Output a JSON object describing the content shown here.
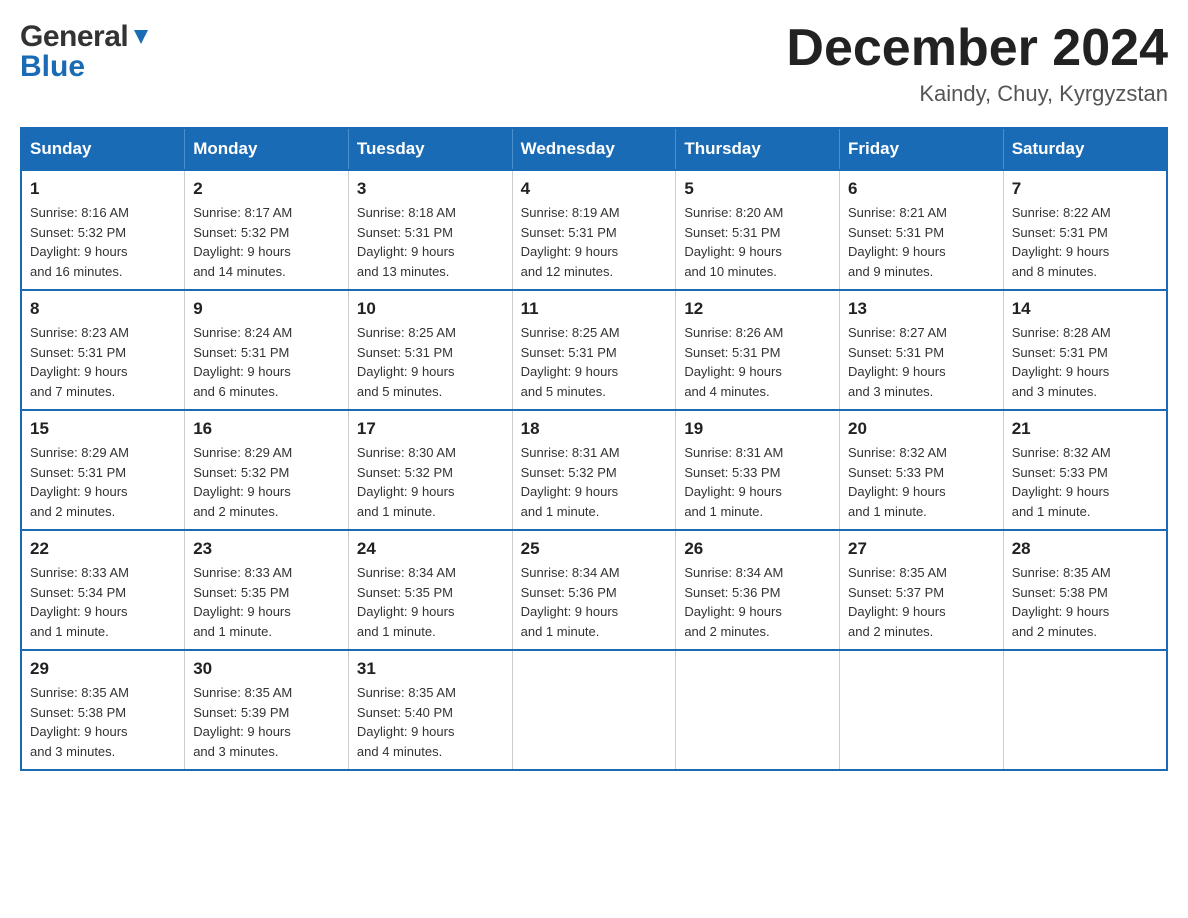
{
  "header": {
    "logo_general": "General",
    "logo_blue": "Blue",
    "title": "December 2024",
    "subtitle": "Kaindy, Chuy, Kyrgyzstan"
  },
  "calendar": {
    "days_of_week": [
      "Sunday",
      "Monday",
      "Tuesday",
      "Wednesday",
      "Thursday",
      "Friday",
      "Saturday"
    ],
    "weeks": [
      [
        {
          "day": "1",
          "sunrise": "8:16 AM",
          "sunset": "5:32 PM",
          "daylight": "9 hours and 16 minutes."
        },
        {
          "day": "2",
          "sunrise": "8:17 AM",
          "sunset": "5:32 PM",
          "daylight": "9 hours and 14 minutes."
        },
        {
          "day": "3",
          "sunrise": "8:18 AM",
          "sunset": "5:31 PM",
          "daylight": "9 hours and 13 minutes."
        },
        {
          "day": "4",
          "sunrise": "8:19 AM",
          "sunset": "5:31 PM",
          "daylight": "9 hours and 12 minutes."
        },
        {
          "day": "5",
          "sunrise": "8:20 AM",
          "sunset": "5:31 PM",
          "daylight": "9 hours and 10 minutes."
        },
        {
          "day": "6",
          "sunrise": "8:21 AM",
          "sunset": "5:31 PM",
          "daylight": "9 hours and 9 minutes."
        },
        {
          "day": "7",
          "sunrise": "8:22 AM",
          "sunset": "5:31 PM",
          "daylight": "9 hours and 8 minutes."
        }
      ],
      [
        {
          "day": "8",
          "sunrise": "8:23 AM",
          "sunset": "5:31 PM",
          "daylight": "9 hours and 7 minutes."
        },
        {
          "day": "9",
          "sunrise": "8:24 AM",
          "sunset": "5:31 PM",
          "daylight": "9 hours and 6 minutes."
        },
        {
          "day": "10",
          "sunrise": "8:25 AM",
          "sunset": "5:31 PM",
          "daylight": "9 hours and 5 minutes."
        },
        {
          "day": "11",
          "sunrise": "8:25 AM",
          "sunset": "5:31 PM",
          "daylight": "9 hours and 5 minutes."
        },
        {
          "day": "12",
          "sunrise": "8:26 AM",
          "sunset": "5:31 PM",
          "daylight": "9 hours and 4 minutes."
        },
        {
          "day": "13",
          "sunrise": "8:27 AM",
          "sunset": "5:31 PM",
          "daylight": "9 hours and 3 minutes."
        },
        {
          "day": "14",
          "sunrise": "8:28 AM",
          "sunset": "5:31 PM",
          "daylight": "9 hours and 3 minutes."
        }
      ],
      [
        {
          "day": "15",
          "sunrise": "8:29 AM",
          "sunset": "5:31 PM",
          "daylight": "9 hours and 2 minutes."
        },
        {
          "day": "16",
          "sunrise": "8:29 AM",
          "sunset": "5:32 PM",
          "daylight": "9 hours and 2 minutes."
        },
        {
          "day": "17",
          "sunrise": "8:30 AM",
          "sunset": "5:32 PM",
          "daylight": "9 hours and 1 minute."
        },
        {
          "day": "18",
          "sunrise": "8:31 AM",
          "sunset": "5:32 PM",
          "daylight": "9 hours and 1 minute."
        },
        {
          "day": "19",
          "sunrise": "8:31 AM",
          "sunset": "5:33 PM",
          "daylight": "9 hours and 1 minute."
        },
        {
          "day": "20",
          "sunrise": "8:32 AM",
          "sunset": "5:33 PM",
          "daylight": "9 hours and 1 minute."
        },
        {
          "day": "21",
          "sunrise": "8:32 AM",
          "sunset": "5:33 PM",
          "daylight": "9 hours and 1 minute."
        }
      ],
      [
        {
          "day": "22",
          "sunrise": "8:33 AM",
          "sunset": "5:34 PM",
          "daylight": "9 hours and 1 minute."
        },
        {
          "day": "23",
          "sunrise": "8:33 AM",
          "sunset": "5:35 PM",
          "daylight": "9 hours and 1 minute."
        },
        {
          "day": "24",
          "sunrise": "8:34 AM",
          "sunset": "5:35 PM",
          "daylight": "9 hours and 1 minute."
        },
        {
          "day": "25",
          "sunrise": "8:34 AM",
          "sunset": "5:36 PM",
          "daylight": "9 hours and 1 minute."
        },
        {
          "day": "26",
          "sunrise": "8:34 AM",
          "sunset": "5:36 PM",
          "daylight": "9 hours and 2 minutes."
        },
        {
          "day": "27",
          "sunrise": "8:35 AM",
          "sunset": "5:37 PM",
          "daylight": "9 hours and 2 minutes."
        },
        {
          "day": "28",
          "sunrise": "8:35 AM",
          "sunset": "5:38 PM",
          "daylight": "9 hours and 2 minutes."
        }
      ],
      [
        {
          "day": "29",
          "sunrise": "8:35 AM",
          "sunset": "5:38 PM",
          "daylight": "9 hours and 3 minutes."
        },
        {
          "day": "30",
          "sunrise": "8:35 AM",
          "sunset": "5:39 PM",
          "daylight": "9 hours and 3 minutes."
        },
        {
          "day": "31",
          "sunrise": "8:35 AM",
          "sunset": "5:40 PM",
          "daylight": "9 hours and 4 minutes."
        },
        null,
        null,
        null,
        null
      ]
    ],
    "labels": {
      "sunrise": "Sunrise:",
      "sunset": "Sunset:",
      "daylight": "Daylight:"
    }
  }
}
